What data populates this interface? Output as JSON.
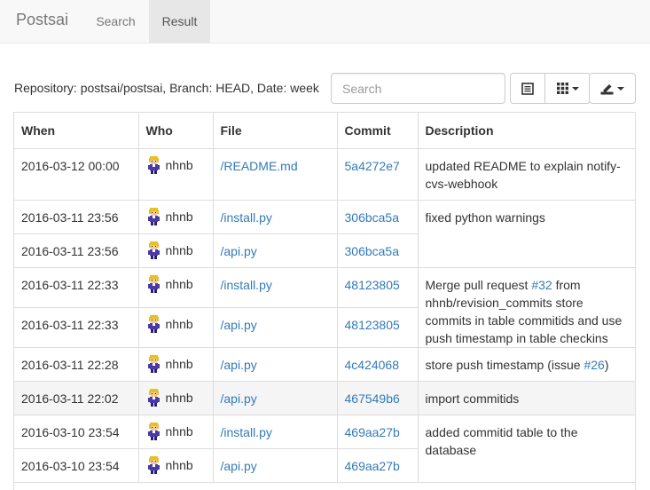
{
  "navbar": {
    "brand": "Postsai",
    "tabs": [
      {
        "label": "Search",
        "active": false
      },
      {
        "label": "Result",
        "active": true
      }
    ]
  },
  "toolbar": {
    "repo_info": "Repository: postsai/postsai, Branch: HEAD, Date: week",
    "search_placeholder": "Search",
    "buttons": [
      "list-icon",
      "columns-grid-icon",
      "export-icon"
    ]
  },
  "table": {
    "headers": [
      "When",
      "Who",
      "File",
      "Commit",
      "Description"
    ],
    "rows": [
      {
        "when": "2016-03-12 00:00",
        "who": "nhnb",
        "file": "/README.md",
        "commit": "5a4272e7"
      },
      {
        "when": "2016-03-11 23:56",
        "who": "nhnb",
        "file": "/install.py",
        "commit": "306bca5a"
      },
      {
        "when": "2016-03-11 23:56",
        "who": "nhnb",
        "file": "/api.py",
        "commit": "306bca5a"
      },
      {
        "when": "2016-03-11 22:33",
        "who": "nhnb",
        "file": "/install.py",
        "commit": "48123805"
      },
      {
        "when": "2016-03-11 22:33",
        "who": "nhnb",
        "file": "/api.py",
        "commit": "48123805"
      },
      {
        "when": "2016-03-11 22:28",
        "who": "nhnb",
        "file": "/api.py",
        "commit": "4c424068"
      },
      {
        "when": "2016-03-11 22:02",
        "who": "nhnb",
        "file": "/api.py",
        "commit": "467549b6"
      },
      {
        "when": "2016-03-10 23:54",
        "who": "nhnb",
        "file": "/install.py",
        "commit": "469aa27b"
      },
      {
        "when": "2016-03-10 23:54",
        "who": "nhnb",
        "file": "/api.py",
        "commit": "469aa27b"
      }
    ],
    "descriptions": {
      "d0": "updated README to explain notify-cvs-webhook",
      "d1": "fixed python warnings",
      "d2_pre": "Merge pull request ",
      "d2_link": "#32",
      "d2_post": " from nhnb/revision_commits store commits in table commitids and use push timestamp in table checkins",
      "d3_pre": "store push timestamp (issue ",
      "d3_link": "#26",
      "d3_post": ")",
      "d4": "import commitids",
      "d5": "added commitid table to the database"
    }
  },
  "colors": {
    "link": "#337ab7",
    "navbar_bg": "#f8f8f8",
    "active_tab_bg": "#e7e7e7",
    "highlight_row": "#f5f5f5"
  }
}
